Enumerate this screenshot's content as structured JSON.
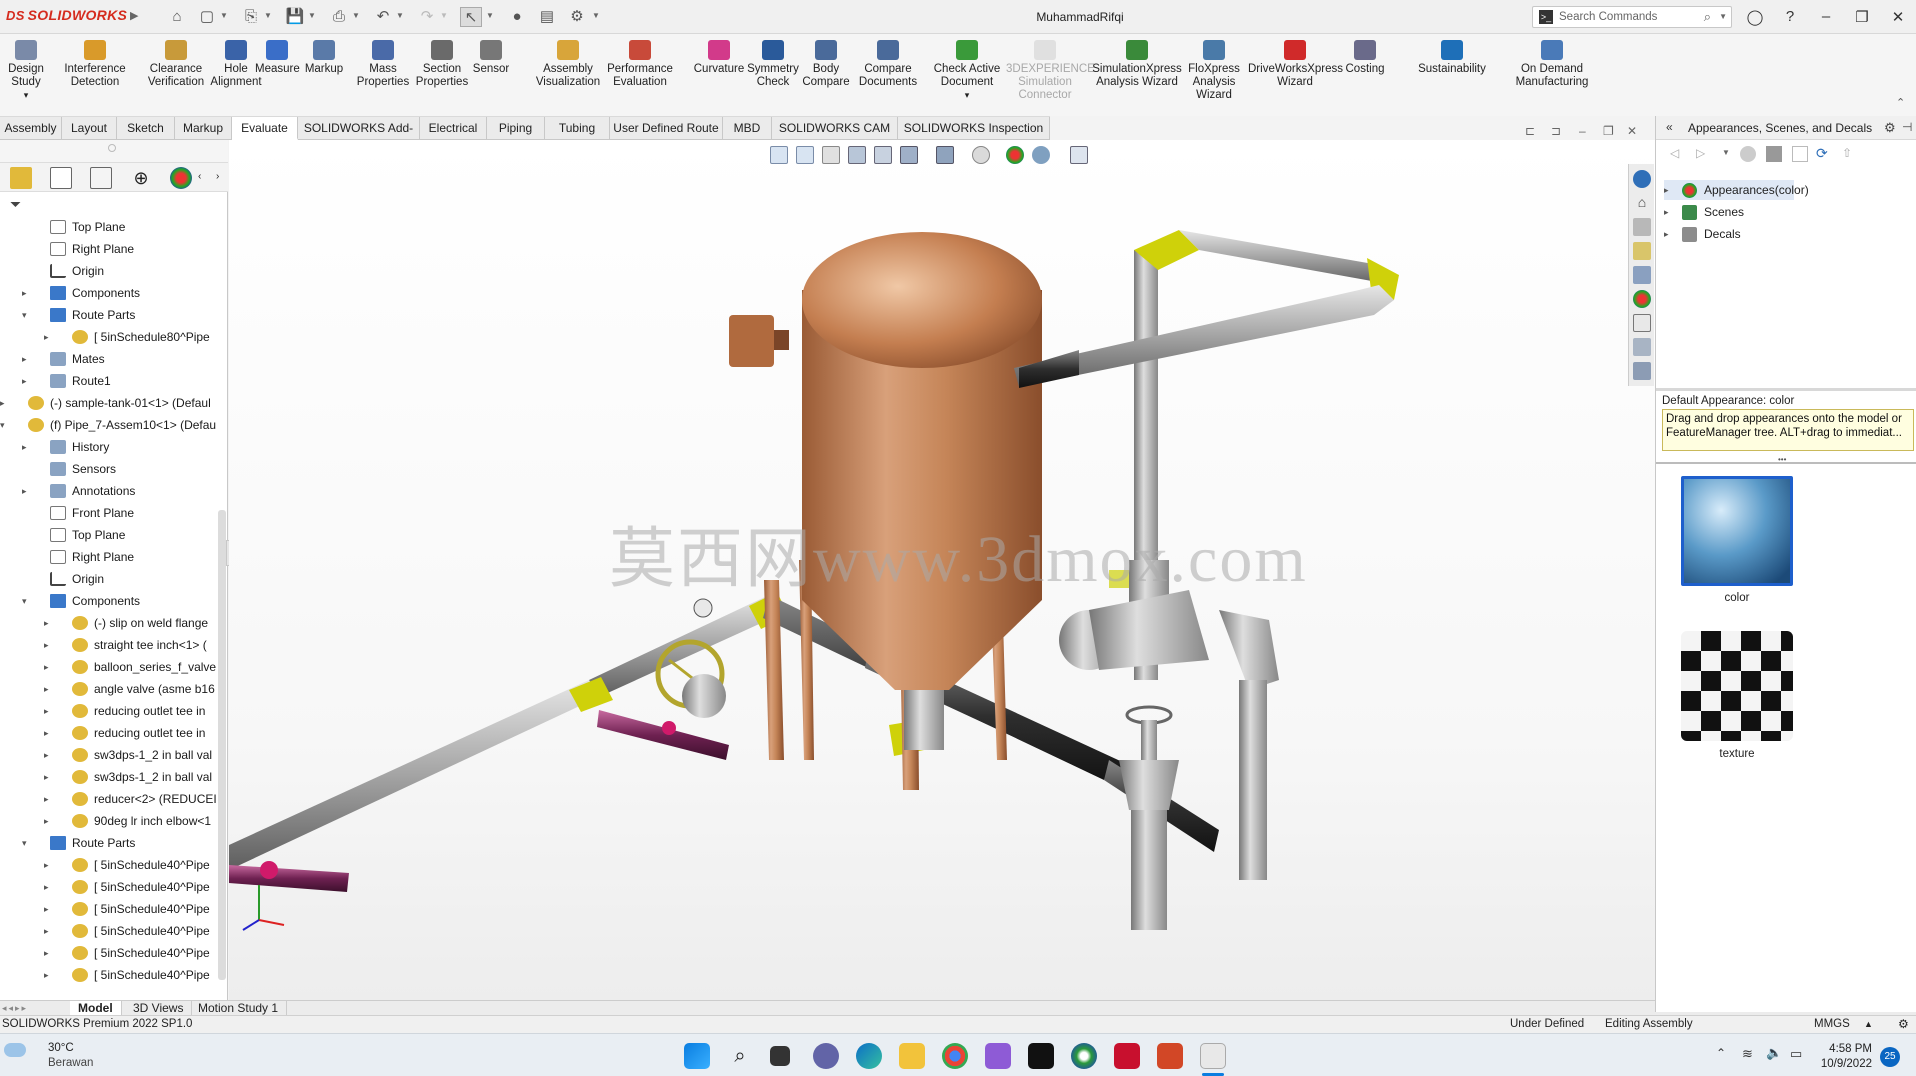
{
  "app": {
    "name": "SOLIDWORKS",
    "title": "MuhammadRifqi"
  },
  "search": {
    "placeholder": "Search Commands"
  },
  "ribbon": {
    "buttons": [
      {
        "label": "Design\nStudy",
        "l1": "Design",
        "l2": "Study",
        "l3": ""
      },
      {
        "l1": "Interference",
        "l2": "Detection",
        "l3": ""
      },
      {
        "l1": "Clearance",
        "l2": "Verification",
        "l3": ""
      },
      {
        "l1": "Hole",
        "l2": "Alignment",
        "l3": ""
      },
      {
        "l1": "Measure",
        "l2": "",
        "l3": ""
      },
      {
        "l1": "Markup",
        "l2": "",
        "l3": ""
      },
      {
        "l1": "Mass",
        "l2": "Properties",
        "l3": ""
      },
      {
        "l1": "Section",
        "l2": "Properties",
        "l3": ""
      },
      {
        "l1": "Sensor",
        "l2": "",
        "l3": ""
      },
      {
        "l1": "Assembly",
        "l2": "Visualization",
        "l3": ""
      },
      {
        "l1": "Performance",
        "l2": "Evaluation",
        "l3": ""
      },
      {
        "l1": "Curvature",
        "l2": "",
        "l3": ""
      },
      {
        "l1": "Symmetry",
        "l2": "Check",
        "l3": ""
      },
      {
        "l1": "Body",
        "l2": "Compare",
        "l3": ""
      },
      {
        "l1": "Compare",
        "l2": "Documents",
        "l3": ""
      },
      {
        "l1": "Check Active",
        "l2": "Document",
        "l3": ""
      },
      {
        "l1": "3DEXPERIENCE",
        "l2": "Simulation",
        "l3": "Connector"
      },
      {
        "l1": "SimulationXpress",
        "l2": "Analysis Wizard",
        "l3": ""
      },
      {
        "l1": "FloXpress",
        "l2": "Analysis",
        "l3": "Wizard"
      },
      {
        "l1": "DriveWorksXpress",
        "l2": "Wizard",
        "l3": ""
      },
      {
        "l1": "Costing",
        "l2": "",
        "l3": ""
      },
      {
        "l1": "Sustainability",
        "l2": "",
        "l3": ""
      },
      {
        "l1": "On Demand",
        "l2": "Manufacturing",
        "l3": ""
      }
    ]
  },
  "tabs": [
    "Assembly",
    "Layout",
    "Sketch",
    "Markup",
    "Evaluate",
    "SOLIDWORKS Add-Ins",
    "Electrical",
    "Piping",
    "Tubing",
    "User Defined Route",
    "MBD",
    "SOLIDWORKS CAM",
    "SOLIDWORKS Inspection"
  ],
  "active_tab": "Evaluate",
  "tree": [
    {
      "label": "Top Plane",
      "icon": "plane-icon"
    },
    {
      "label": "Right Plane",
      "icon": "plane-icon"
    },
    {
      "label": "Origin",
      "icon": "origin-icon"
    },
    {
      "label": "Components",
      "icon": "folder-icon"
    },
    {
      "label": "Route Parts",
      "icon": "folder-icon"
    },
    {
      "label": "[ 5inSchedule80^Pipe",
      "icon": "part-icon"
    },
    {
      "label": "Mates",
      "icon": "mates-icon"
    },
    {
      "label": "Route1",
      "icon": "route-icon"
    },
    {
      "label": "(-) sample-tank-01<1> (Defaul",
      "icon": "assembly-icon"
    },
    {
      "label": "(f) Pipe_7-Assem10<1> (Defau",
      "icon": "assembly-icon"
    },
    {
      "label": "History",
      "icon": "history-icon"
    },
    {
      "label": "Sensors",
      "icon": "sensor-icon"
    },
    {
      "label": "Annotations",
      "icon": "annotation-icon"
    },
    {
      "label": "Front Plane",
      "icon": "plane-icon"
    },
    {
      "label": "Top Plane",
      "icon": "plane-icon"
    },
    {
      "label": "Right Plane",
      "icon": "plane-icon"
    },
    {
      "label": "Origin",
      "icon": "origin-icon"
    },
    {
      "label": "Components",
      "icon": "folder-icon"
    },
    {
      "label": "(-) slip on weld flange",
      "icon": "part-icon"
    },
    {
      "label": "straight tee inch<1> (",
      "icon": "part-icon"
    },
    {
      "label": "balloon_series_f_valve",
      "icon": "part-icon"
    },
    {
      "label": "angle valve (asme b16",
      "icon": "part-icon"
    },
    {
      "label": "reducing outlet tee in",
      "icon": "part-icon"
    },
    {
      "label": "reducing outlet tee in",
      "icon": "part-icon"
    },
    {
      "label": "sw3dps-1_2 in ball val",
      "icon": "part-icon"
    },
    {
      "label": "sw3dps-1_2 in ball val",
      "icon": "part-icon"
    },
    {
      "label": "reducer<2> (REDUCEI",
      "icon": "part-icon"
    },
    {
      "label": "90deg lr inch elbow<1",
      "icon": "part-icon"
    },
    {
      "label": "Route Parts",
      "icon": "folder-icon"
    },
    {
      "label": "[ 5inSchedule40^Pipe",
      "icon": "part-icon"
    },
    {
      "label": "[ 5inSchedule40^Pipe",
      "icon": "part-icon"
    },
    {
      "label": "[ 5inSchedule40^Pipe",
      "icon": "part-icon"
    },
    {
      "label": "[ 5inSchedule40^Pipe",
      "icon": "part-icon"
    },
    {
      "label": "[ 5inSchedule40^Pipe",
      "icon": "part-icon"
    },
    {
      "label": "[ 5inSchedule40^Pipe",
      "icon": "part-icon"
    }
  ],
  "bottom_tabs": [
    "Model",
    "3D Views",
    "Motion Study 1"
  ],
  "watermark": "莫西网www.3dmox.com",
  "rightpane": {
    "title": "Appearances, Scenes, and Decals",
    "items": [
      "Appearances(color)",
      "Scenes",
      "Decals"
    ],
    "default_appearance": "Default Appearance: color",
    "tip": "Drag and drop appearances onto the model or FeatureManager tree.  ALT+drag to immediat...",
    "swatches": [
      "color",
      "texture"
    ]
  },
  "status": {
    "version": "SOLIDWORKS Premium 2022 SP1.0",
    "state": "Under Defined",
    "mode": "Editing Assembly",
    "units": "MMGS"
  },
  "taskbar": {
    "temp": "30°C",
    "weather": "Berawan",
    "time": "4:58 PM",
    "date": "10/9/2022",
    "badge": "25"
  },
  "colors": {
    "accent": "#d52b1e",
    "selection": "#1e5fcc",
    "tank": "#c4845a",
    "pipe": "#a9a9a9",
    "joint": "#cfd10a"
  }
}
